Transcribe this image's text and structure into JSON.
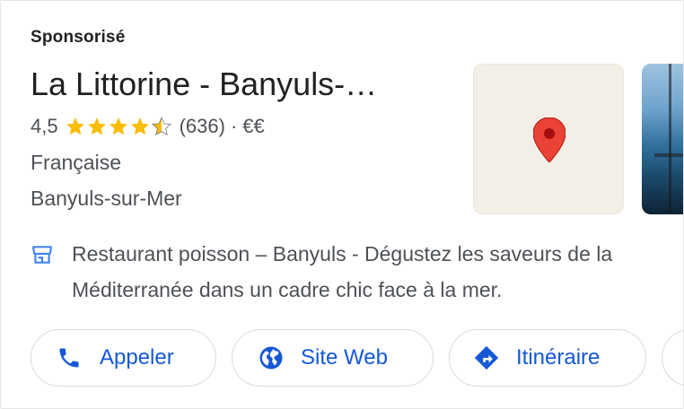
{
  "ad": {
    "sponsored_label": "Sponsorisé",
    "title": "La Littorine - Banyuls-…",
    "rating": "4,5",
    "rating_value": 4.5,
    "reviews": "(636)",
    "separator": "·",
    "price": "€€",
    "cuisine": "Française",
    "location": "Banyuls-sur-Mer",
    "description": "Restaurant poisson – Banyuls - Dégustez les saveurs de la Méditerranée dans un cadre chic face à la mer."
  },
  "actions": {
    "call_label": "Appeler",
    "website_label": "Site Web",
    "directions_label": "Itinéraire"
  },
  "icons": {
    "rating": "star-icon",
    "map": "map-pin-icon",
    "store": "storefront-icon",
    "call": "phone-icon",
    "website": "globe-icon",
    "directions": "directions-icon"
  },
  "colors": {
    "star": "#fbbc04",
    "accent": "#1558d6",
    "pin": "#ea4335",
    "map_bg": "#f3efe6"
  }
}
